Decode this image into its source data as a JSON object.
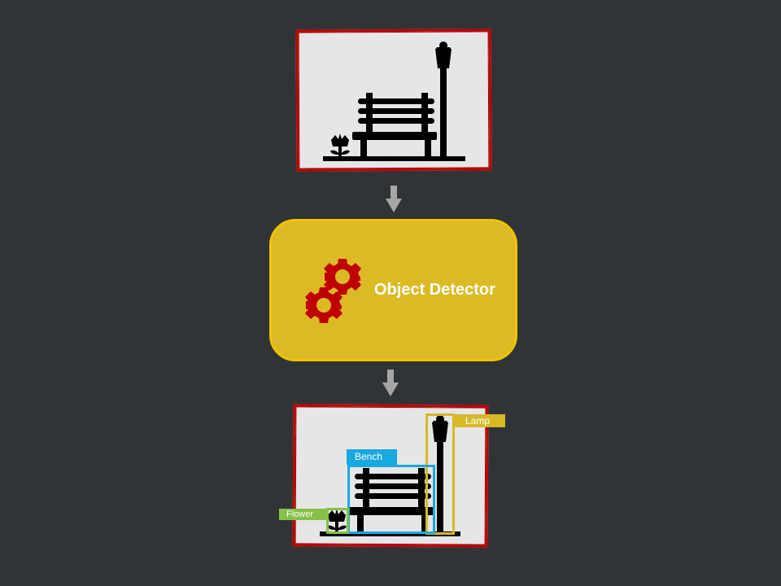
{
  "detector": {
    "label": "Object Detector"
  },
  "detections": [
    {
      "label": "Lamp",
      "color": "#d7b827"
    },
    {
      "label": "Bench",
      "color": "#19a8e0"
    },
    {
      "label": "Flower",
      "color": "#86c04a"
    }
  ],
  "colors": {
    "background": "#313436",
    "frame_border": "#c00000",
    "frame_fill": "#e6e6e6",
    "detector_fill": "#dbba25",
    "gear": "#c00000",
    "arrow": "#a6a6a6"
  }
}
